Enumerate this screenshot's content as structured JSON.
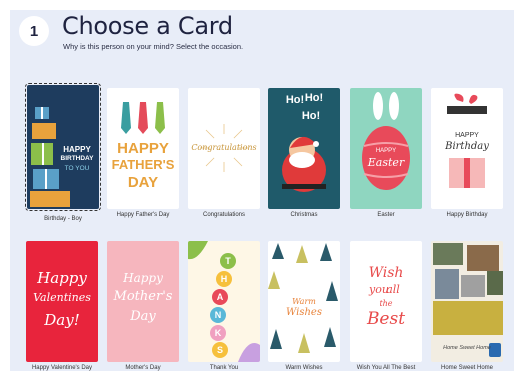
{
  "header": {
    "step_number": "1",
    "title": "Choose a Card",
    "subtitle": "Why is this person on your mind? Select the occasion."
  },
  "cards_row1": [
    {
      "label": "Birthday - Boy",
      "art": [
        "HAPPY",
        "BIRTHDAY",
        "TO YOU"
      ]
    },
    {
      "label": "Happy Father's Day",
      "art": [
        "HAPPY",
        "FATHER'S",
        "DAY"
      ]
    },
    {
      "label": "Congratulations",
      "art": [
        "Congratulations"
      ]
    },
    {
      "label": "Christmas",
      "art": [
        "Ho!",
        "Ho!",
        "Ho!"
      ]
    },
    {
      "label": "Easter",
      "art": [
        "HAPPY",
        "Easter"
      ]
    },
    {
      "label": "Happy Birthday",
      "art": [
        "HAPPY",
        "Birthday"
      ]
    }
  ],
  "cards_row2": [
    {
      "label": "Happy Valentine's Day",
      "art": [
        "Happy",
        "Valentines",
        "Day!"
      ]
    },
    {
      "label": "Mother's Day",
      "art": [
        "Happy",
        "Mother's",
        "Day"
      ]
    },
    {
      "label": "Thank You",
      "art": [
        "T",
        "H",
        "A",
        "N",
        "K",
        "S"
      ]
    },
    {
      "label": "Warm Wishes",
      "art": [
        "Warm",
        "Wishes"
      ]
    },
    {
      "label": "Wish You All The Best",
      "art": [
        "Wish",
        "you",
        "all",
        "the",
        "Best"
      ]
    },
    {
      "label": "Home Sweet Home",
      "art": [
        "Home Sweet Home"
      ]
    }
  ],
  "colors": {
    "panel": "#e8edf8",
    "title": "#1f2340"
  }
}
